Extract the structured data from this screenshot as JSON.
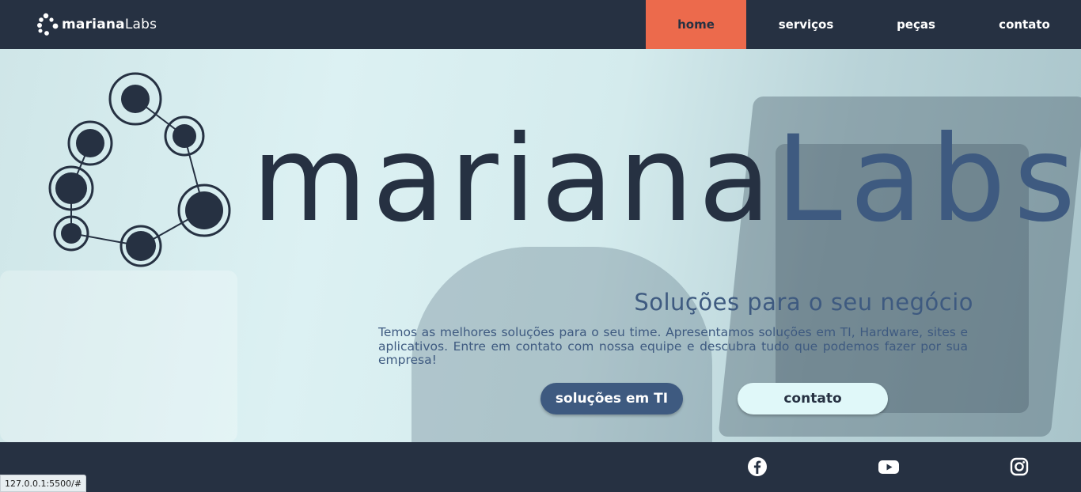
{
  "nav": {
    "logo": {
      "bold": "mariana",
      "light": "Labs"
    },
    "items": [
      {
        "label": "home",
        "active": true
      },
      {
        "label": "serviços",
        "active": false
      },
      {
        "label": "peças",
        "active": false
      },
      {
        "label": "contato",
        "active": false
      }
    ]
  },
  "hero": {
    "brand_bold": "mariana",
    "brand_light": "Labs",
    "tagline": "Soluções para o seu negócio",
    "description": "Temos as melhores soluções para o seu time. Apresentamos soluções em TI, Hardware, sites e aplicativos. Entre em contato com nossa equipe e descubra tudo que podemos fazer por sua empresa!",
    "buttons": {
      "primary": "soluções em TI",
      "secondary": "contato"
    }
  },
  "footer": {
    "social": [
      {
        "icon": "facebook-icon"
      },
      {
        "icon": "youtube-icon"
      },
      {
        "icon": "instagram-icon"
      }
    ]
  },
  "status_bar": {
    "url": "127.0.0.1:5500/#"
  },
  "colors": {
    "navy": "#263142",
    "accent": "#ec6a4c",
    "blue": "#3e5a80",
    "light": "#e0f8f9"
  }
}
